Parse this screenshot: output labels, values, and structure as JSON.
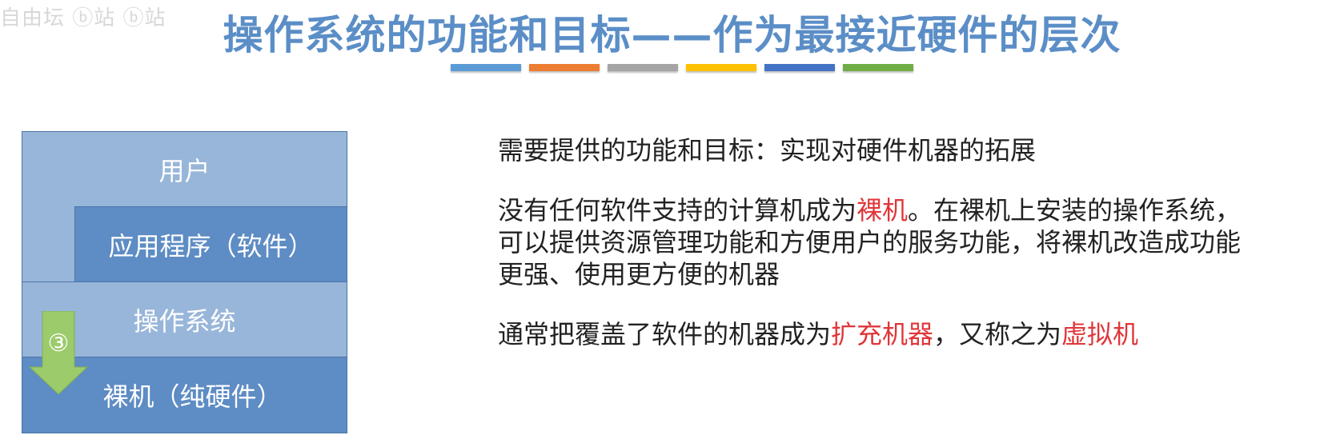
{
  "watermark": "自由坛 ⓑ站 ⓑ站",
  "title": "操作系统的功能和目标——作为最接近硬件的层次",
  "colors": {
    "title": "#5b8ec7",
    "highlight": "#e0363a",
    "layer_light": "#98b6d9",
    "layer_dark": "#5e8cc4",
    "arrow": "#9bcb6b",
    "bars": [
      "#5b9bd5",
      "#ed7d31",
      "#a5a5a5",
      "#ffc000",
      "#4472c4",
      "#70ad47"
    ]
  },
  "diagram": {
    "layers": {
      "user": "用户",
      "app": "应用程序（软件）",
      "os": "操作系统",
      "hardware": "裸机（纯硬件）"
    },
    "arrow_label": "③"
  },
  "content": {
    "p1": "需要提供的功能和目标：实现对硬件机器的拓展",
    "p2": {
      "a": "没有任何软件支持的计算机成为",
      "hl": "裸机",
      "b": "。在裸机上安装的操作系统，",
      "line2": "可以提供资源管理功能和方便用户的服务功能，将裸机改造成功能",
      "line3": "更强、使用更方便的机器"
    },
    "p3": {
      "a": "通常把覆盖了软件的机器成为",
      "hl1": "扩充机器",
      "b": "，又称之为",
      "hl2": "虚拟机"
    }
  }
}
